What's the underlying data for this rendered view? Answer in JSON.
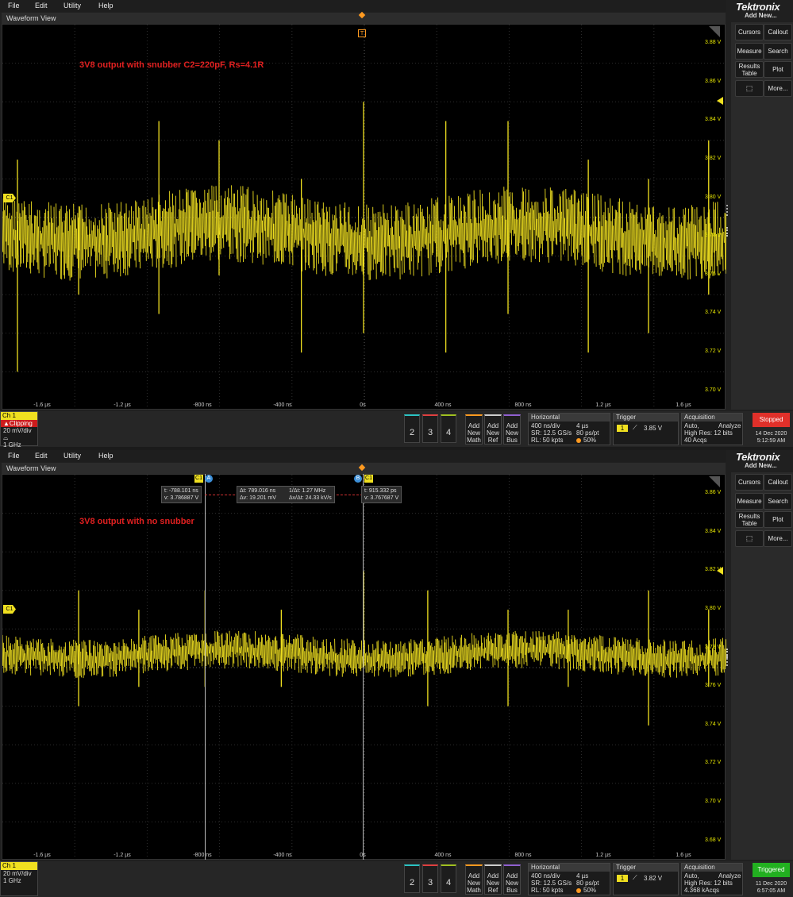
{
  "menu": [
    "File",
    "Edit",
    "Utility",
    "Help"
  ],
  "brand": "Tektronix",
  "add_new": "Add New...",
  "side_buttons": {
    "cursors": "Cursors",
    "callout": "Callout",
    "measure": "Measure",
    "search": "Search",
    "results_table_1": "Results",
    "results_table_2": "Table",
    "plot": "Plot",
    "more": "More..."
  },
  "waveform_view_title": "Waveform View",
  "colors": {
    "trace": "#f0e020",
    "annotation": "#e02020",
    "stopped": "#e0302a",
    "triggered": "#22b020"
  },
  "x_labels": [
    "-1.6 µs",
    "-1.2 µs",
    "-800 ns",
    "-400 ns",
    "0s",
    "400 ns",
    "800 ns",
    "1.2 µs",
    "1.6 µs"
  ],
  "bottom_common": {
    "ch_title": "Ch 1",
    "bandwidth": "1 GHz",
    "ch_scale": "20 mV/div",
    "btn_2": "2",
    "btn_3": "3",
    "btn_4": "4",
    "add": "Add",
    "new": "New",
    "math": "Math",
    "ref": "Ref",
    "bus": "Bus",
    "horizontal": "Horizontal",
    "h_scale": "400 ns/div",
    "h_total": "4 µs",
    "h_sr": "SR: 12.5 GS/s",
    "h_ps": "80 ps/pt",
    "h_rl": "RL: 50 kpts",
    "h_pos": "50%",
    "trigger": "Trigger",
    "trigger_ch": "1",
    "acquisition": "Acquisition",
    "acq_mode": "Auto,",
    "acq_analyze": "Analyze",
    "acq_res": "High Res: 12 bits"
  },
  "screens": [
    {
      "annotation": "3V8 output with snubber C2=220pF, Rs=4.1R",
      "y_labels": [
        "3.88 V",
        "3.86 V",
        "3.84 V",
        "3.82 V",
        "3.80 V",
        "3.78 V",
        "3.76 V",
        "3.74 V",
        "3.72 V",
        "3.70 V"
      ],
      "clipping": "Clipping",
      "trigger_level": "3.85 V",
      "acq_count": "40 Acqs",
      "status": "Stopped",
      "date": "14 Dec 2020",
      "time": "5:12:59 AM",
      "ch_marker": "C1",
      "trig_marker": "T"
    },
    {
      "annotation": "3V8 output with no snubber",
      "y_labels": [
        "3.86 V",
        "3.84 V",
        "3.82 V",
        "3.80 V",
        "3.78 V",
        "3.76 V",
        "3.74 V",
        "3.72 V",
        "3.70 V",
        "3.68 V"
      ],
      "trigger_level": "3.82 V",
      "acq_count": "4.368 kAcqs",
      "status": "Triggered",
      "date": "11 Dec 2020",
      "time": "6:57:05 AM",
      "ch_marker": "C1",
      "cursor_a": {
        "label": "A",
        "ch": "C1",
        "t": "t: -788.101 ns",
        "v": "v: 3.786887 V"
      },
      "cursor_b": {
        "label": "B",
        "ch": "C1",
        "t": "t: 915.332 ps",
        "v": "v: 3.767687 V"
      },
      "delta": {
        "dt": "Δt: 789.016 ns",
        "inv_dt": "1/Δt: 1.27 MHz",
        "dv": "Δv: 19.201 mV",
        "dvdt": "Δv/Δt: 24.33 kV/s"
      }
    }
  ],
  "chart_data": [
    {
      "type": "line",
      "title": "3V8 output with snubber C2=220pF, Rs=4.1R",
      "x_unit": "s",
      "xlim": [
        -1.8e-06,
        1.8e-06
      ],
      "y_unit": "V",
      "ylim": [
        3.69,
        3.89
      ],
      "baseline_v": 3.782,
      "noise_band_v": [
        3.762,
        3.802
      ],
      "spikes": [
        {
          "t_ns": -1725,
          "high_v": 3.82,
          "low_v": 3.71
        },
        {
          "t_ns": -1420,
          "high_v": 3.79,
          "low_v": 3.75
        },
        {
          "t_ns": -1020,
          "high_v": 3.84,
          "low_v": 3.74
        },
        {
          "t_ns": -720,
          "high_v": 3.83,
          "low_v": 3.76
        },
        {
          "t_ns": -310,
          "high_v": 3.81,
          "low_v": 3.72
        },
        {
          "t_ns": 0,
          "high_v": 3.85,
          "low_v": 3.73
        },
        {
          "t_ns": 410,
          "high_v": 3.84,
          "low_v": 3.72
        },
        {
          "t_ns": 720,
          "high_v": 3.84,
          "low_v": 3.74
        },
        {
          "t_ns": 1120,
          "high_v": 3.82,
          "low_v": 3.72
        },
        {
          "t_ns": 1420,
          "high_v": 3.81,
          "low_v": 3.73
        },
        {
          "t_ns": 1720,
          "high_v": 3.83,
          "low_v": 3.75
        }
      ]
    },
    {
      "type": "line",
      "title": "3V8 output with no snubber",
      "x_unit": "s",
      "xlim": [
        -1.8e-06,
        1.8e-06
      ],
      "y_unit": "V",
      "ylim": [
        3.67,
        3.87
      ],
      "baseline_v": 3.777,
      "noise_band_v": [
        3.767,
        3.787
      ],
      "spikes": [
        {
          "t_ns": -1420,
          "high_v": 3.81,
          "low_v": 3.75
        },
        {
          "t_ns": -1120,
          "high_v": 3.8,
          "low_v": 3.76
        },
        {
          "t_ns": -790,
          "high_v": 3.81,
          "low_v": 3.76
        },
        {
          "t_ns": -410,
          "high_v": 3.8,
          "low_v": 3.76
        },
        {
          "t_ns": 0,
          "high_v": 3.82,
          "low_v": 3.77
        },
        {
          "t_ns": 320,
          "high_v": 3.81,
          "low_v": 3.75
        },
        {
          "t_ns": 720,
          "high_v": 3.8,
          "low_v": 3.75
        },
        {
          "t_ns": 1020,
          "high_v": 3.8,
          "low_v": 3.76
        },
        {
          "t_ns": 1420,
          "high_v": 3.81,
          "low_v": 3.74
        },
        {
          "t_ns": 1720,
          "high_v": 3.8,
          "low_v": 3.76
        }
      ]
    }
  ]
}
